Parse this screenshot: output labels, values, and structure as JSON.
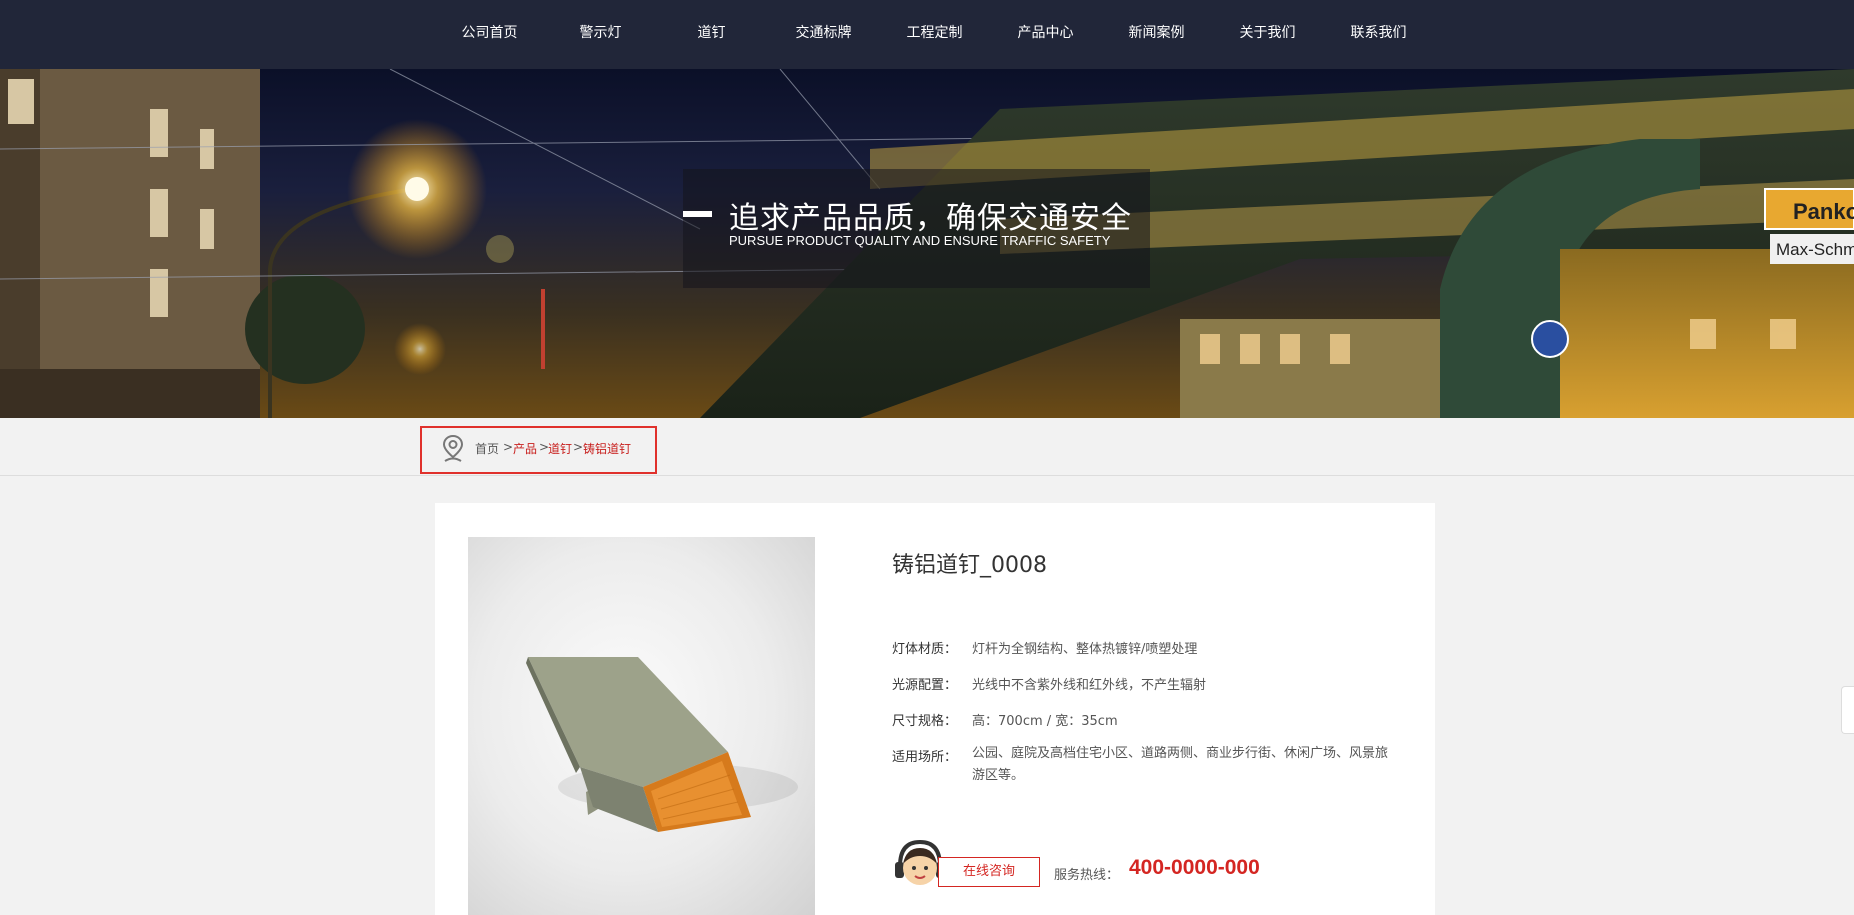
{
  "nav": {
    "items": [
      {
        "label": "公司首页"
      },
      {
        "label": "警示灯"
      },
      {
        "label": "道钉"
      },
      {
        "label": "交通标牌"
      },
      {
        "label": "工程定制"
      },
      {
        "label": "产品中心"
      },
      {
        "label": "新闻案例"
      },
      {
        "label": "关于我们"
      },
      {
        "label": "联系我们"
      }
    ]
  },
  "banner": {
    "slogan_cn": "追求产品品质，确保交通安全",
    "slogan_en": "PURSUE PRODUCT QUALITY AND ENSURE TRAFFIC SAFETY",
    "sign_text": "Panko",
    "sign_text_2": "Max-Schm"
  },
  "breadcrumb": {
    "home": "首页",
    "sep": ">",
    "items": [
      "产品",
      "道钉",
      "铸铝道钉"
    ]
  },
  "product": {
    "title": "铸铝道钉_0008",
    "specs": [
      {
        "label": "灯体材质：",
        "value": "灯杆为全钢结构、整体热镀锌/喷塑处理"
      },
      {
        "label": "光源配置：",
        "value": "光线中不含紫外线和红外线，不产生辐射"
      },
      {
        "label": "尺寸规格：",
        "value": "高：700cm / 宽：35cm"
      },
      {
        "label": "适用场所：",
        "value": "公园、庭院及高档住宅小区、道路两侧、商业步行街、休闲广场、风景旅游区等。"
      }
    ]
  },
  "contact": {
    "consult_label": "在线咨询",
    "hotline_label": "服务热线：",
    "hotline_number": "400-0000-000"
  },
  "colors": {
    "nav_bg": "#212639",
    "accent_red": "#d42622",
    "page_bg": "#f2f2f2"
  }
}
